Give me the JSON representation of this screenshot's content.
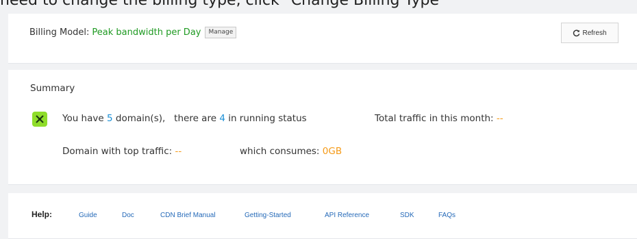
{
  "caption": "need to change the billing type, click \"Change Billing Type\"",
  "billing": {
    "label": "Billing Model:",
    "value": "Peak bandwidth per Day",
    "manage_label": "Manage",
    "refresh_label": "Refresh"
  },
  "summary": {
    "title": "Summary",
    "line1": {
      "prefix": "You have",
      "domain_count": "5",
      "domain_suffix": "domain(s),",
      "running_prefix": "there are",
      "running_count": "4",
      "running_suffix": "in running status",
      "traffic_label": "Total traffic in this month:",
      "traffic_value": "--"
    },
    "line2": {
      "top_label": "Domain with top traffic:",
      "top_value": "--",
      "consumes_label": "which consumes:",
      "consumes_value": "0GB"
    }
  },
  "help": {
    "label": "Help:",
    "links": [
      "Guide",
      "Doc",
      "CDN Brief Manual",
      "Getting-Started",
      "API Reference",
      "SDK",
      "FAQs"
    ]
  },
  "colors": {
    "accent_green": "#1f9a22",
    "link_blue": "#2469b8",
    "count_blue": "#1a8fd6",
    "value_orange": "#f59a17",
    "icon_green": "#8fdd2a"
  }
}
